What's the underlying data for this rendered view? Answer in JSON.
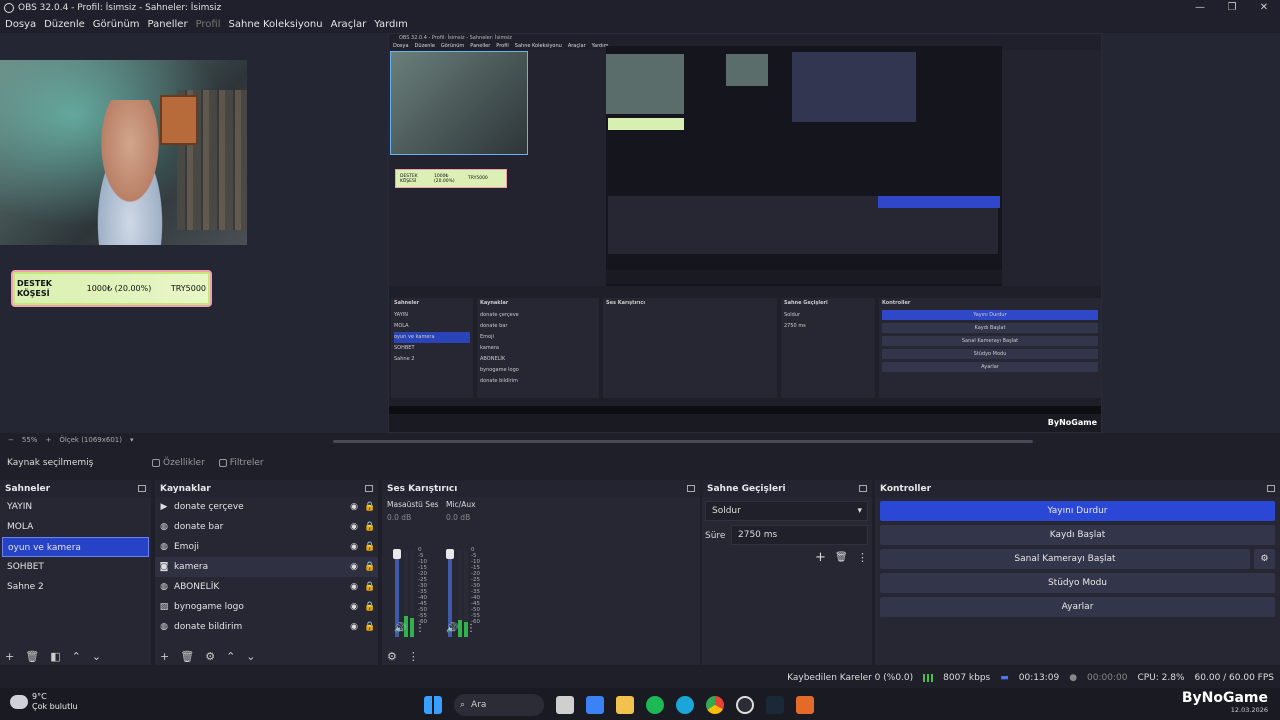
{
  "window": {
    "title": "OBS 32.0.4 - Profil: İsimsiz - Sahneler: İsimsiz",
    "controls": [
      "—",
      "❐",
      "✕"
    ]
  },
  "menu": [
    "Dosya",
    "Düzenle",
    "Görünüm",
    "Paneller",
    "Profil",
    "Sahne Koleksiyonu",
    "Araçlar",
    "Yardım"
  ],
  "preview": {
    "donate": {
      "label": "DESTEK KÖŞESİ",
      "progress": "1000₺ (20.00%)",
      "target": "TRY5000",
      "percent": 20
    }
  },
  "zoom": {
    "minus": "−",
    "level": "55%",
    "plus": "+",
    "scale": "Ölçek (1069x601)"
  },
  "source_toolbar": {
    "selected": "Kaynak seçilmemiş",
    "properties": "Özellikler",
    "filters": "Filtreler"
  },
  "scenes": {
    "title": "Sahneler",
    "items": [
      "YAYIN",
      "MOLA",
      "oyun ve kamera",
      "SOHBET",
      "Sahne 2"
    ],
    "selected_index": 2
  },
  "sources": {
    "title": "Kaynaklar",
    "items": [
      {
        "label": "donate çerçeve",
        "icon": "play-icon"
      },
      {
        "label": "donate bar",
        "icon": "globe-icon"
      },
      {
        "label": "Emoji",
        "icon": "globe-icon"
      },
      {
        "label": "kamera",
        "icon": "camera-icon"
      },
      {
        "label": "ABONELİK",
        "icon": "globe-icon"
      },
      {
        "label": "bynogame logo",
        "icon": "image-icon"
      },
      {
        "label": "donate bildirim",
        "icon": "globe-icon"
      }
    ]
  },
  "mixer": {
    "title": "Ses Karıştırıcı",
    "channels": [
      {
        "name": "Masaüstü Ses",
        "db": "0.0 dB",
        "level": 0.12
      },
      {
        "name": "Mic/Aux",
        "db": "0.0 dB",
        "level": 0.18
      }
    ],
    "ticks": [
      "0",
      "-5",
      "-10",
      "-15",
      "-20",
      "-25",
      "-30",
      "-35",
      "-40",
      "-45",
      "-50",
      "-55",
      "-60"
    ]
  },
  "transitions": {
    "title": "Sahne Geçişleri",
    "type": "Soldur",
    "duration_label": "Süre",
    "duration_value": "2750 ms"
  },
  "controls": {
    "title": "Kontroller",
    "buttons": [
      "Yayını Durdur",
      "Kaydı Başlat",
      "Sanal Kamerayı Başlat",
      "Stüdyo Modu",
      "Ayarlar"
    ]
  },
  "status": {
    "dropped": "Kaybedilen Kareler 0 (%0.0)",
    "bitrate": "8007 kbps",
    "stream_time": "00:13:09",
    "rec_time": "00:00:00",
    "cpu": "CPU: 2.8%",
    "fps": "60.00 / 60.00 FPS"
  },
  "taskbar": {
    "temperature": "9°C",
    "weather": "Çok bulutlu",
    "search": "Ara",
    "brand": "ByNoGame",
    "date": "12.03.2026"
  }
}
